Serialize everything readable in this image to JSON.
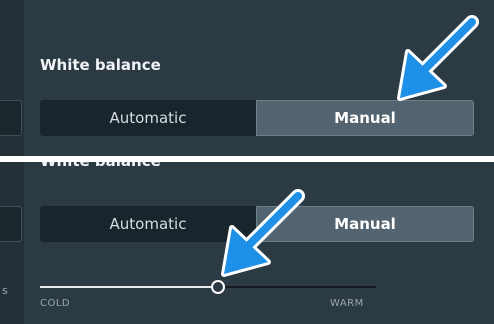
{
  "step1": {
    "section_title": "White balance",
    "options": [
      "Automatic",
      "Manual"
    ],
    "selected": "Manual"
  },
  "step2": {
    "section_title": "White balance",
    "options": [
      "Automatic",
      "Manual"
    ],
    "selected": "Manual",
    "side_letter": "s",
    "slider": {
      "min_label": "COLD",
      "max_label": "WARM",
      "value_fraction": 0.53
    }
  },
  "colors": {
    "panel": "#2c3a44",
    "segment_unselected": "#19252c",
    "segment_selected": "#53636f",
    "arrow": "#1e90e8",
    "slider_fill": "#e7ecef"
  },
  "icons": [
    "pointer-arrow-icon",
    "pointer-arrow-icon"
  ]
}
